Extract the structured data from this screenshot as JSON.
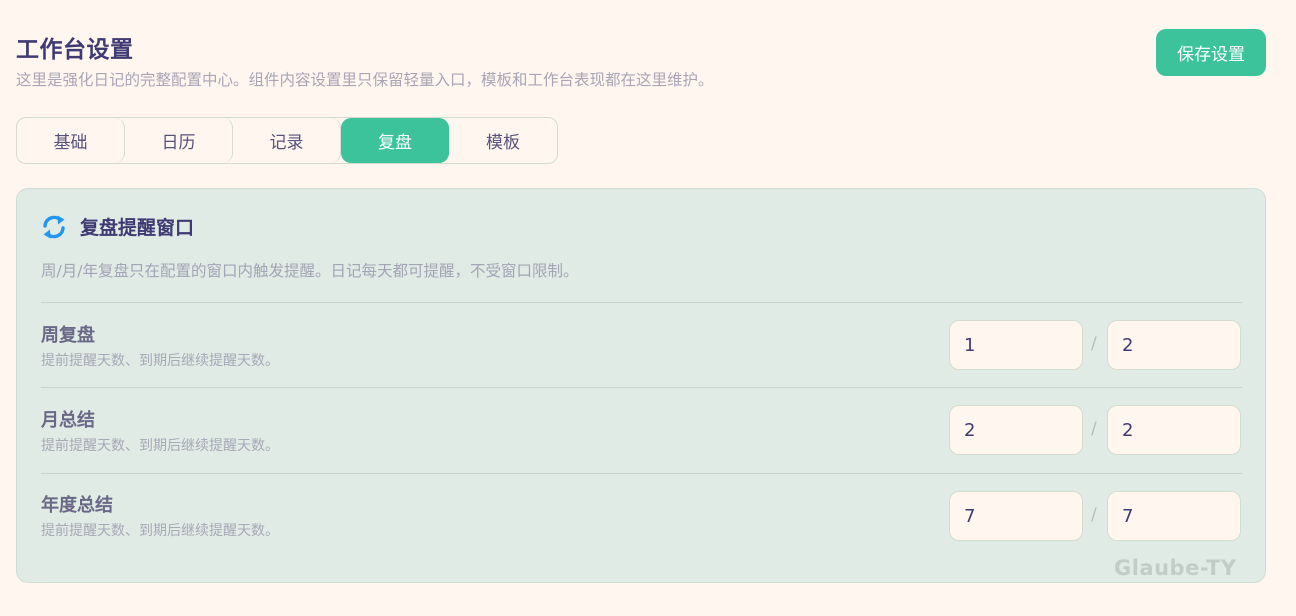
{
  "header": {
    "title": "工作台设置",
    "description": "这里是强化日记的完整配置中心。组件内容设置里只保留轻量入口，模板和工作台表现都在这里维护。",
    "save_label": "保存设置"
  },
  "tabs": [
    {
      "label": "基础",
      "active": false
    },
    {
      "label": "日历",
      "active": false
    },
    {
      "label": "记录",
      "active": false
    },
    {
      "label": "复盘",
      "active": true
    },
    {
      "label": "模板",
      "active": false
    }
  ],
  "panel": {
    "icon": "sync-icon",
    "title": "复盘提醒窗口",
    "description": "周/月/年复盘只在配置的窗口内触发提醒。日记每天都可提醒，不受窗口限制。",
    "separator": "/",
    "rows": [
      {
        "label": "周复盘",
        "hint": "提前提醒天数、到期后继续提醒天数。",
        "before": "1",
        "after": "2"
      },
      {
        "label": "月总结",
        "hint": "提前提醒天数、到期后继续提醒天数。",
        "before": "2",
        "after": "2"
      },
      {
        "label": "年度总结",
        "hint": "提前提醒天数、到期后继续提醒天数。",
        "before": "7",
        "after": "7"
      }
    ]
  },
  "watermark": "Glaube-TY",
  "colors": {
    "accent": "#3cc39c",
    "background": "#fff7ef",
    "panel": "#e0ebe5",
    "title": "#3f3a73",
    "icon": "#2196f3"
  }
}
